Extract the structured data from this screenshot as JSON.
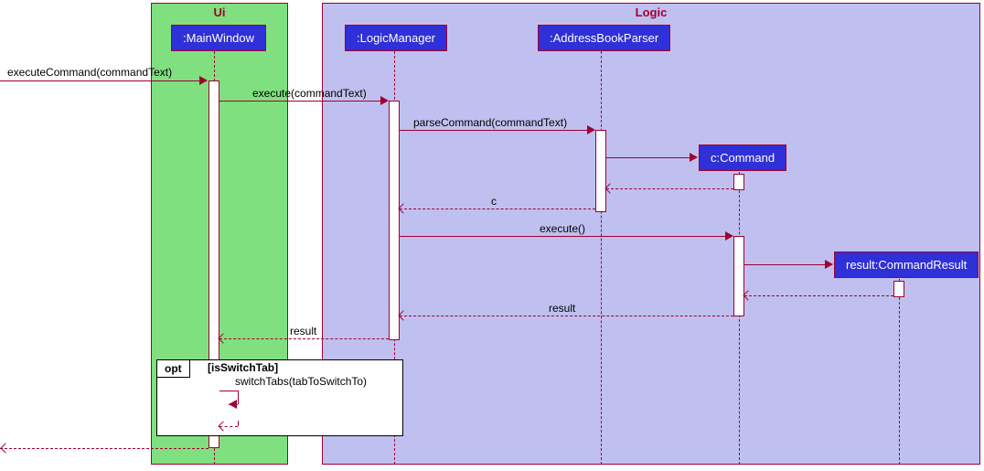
{
  "packages": {
    "ui": {
      "label": "Ui"
    },
    "logic": {
      "label": "Logic"
    }
  },
  "participants": {
    "mainWindow": ":MainWindow",
    "logicManager": ":LogicManager",
    "addressBookParser": ":AddressBookParser",
    "command": "c:Command",
    "commandResult": "result:CommandResult"
  },
  "messages": {
    "m1": "executeCommand(commandText)",
    "m2": "execute(commandText)",
    "m3": "parseCommand(commandText)",
    "r1": "c",
    "m4": "execute()",
    "r2": "result",
    "r3": "result",
    "optGuard": "[isSwitchTab]",
    "m5": "switchTabs(tabToSwitchTo)"
  },
  "fragments": {
    "opt": "opt"
  },
  "chart_data": {
    "type": "sequence-diagram",
    "packages": [
      {
        "name": "Ui",
        "participants": [
          ":MainWindow"
        ]
      },
      {
        "name": "Logic",
        "participants": [
          ":LogicManager",
          ":AddressBookParser",
          "c:Command",
          "result:CommandResult"
        ]
      }
    ],
    "lifelines": [
      ":MainWindow",
      ":LogicManager",
      ":AddressBookParser",
      "c:Command",
      "result:CommandResult"
    ],
    "messages": [
      {
        "from": "caller",
        "to": ":MainWindow",
        "label": "executeCommand(commandText)",
        "type": "sync"
      },
      {
        "from": ":MainWindow",
        "to": ":LogicManager",
        "label": "execute(commandText)",
        "type": "sync"
      },
      {
        "from": ":LogicManager",
        "to": ":AddressBookParser",
        "label": "parseCommand(commandText)",
        "type": "sync"
      },
      {
        "from": ":AddressBookParser",
        "to": "c:Command",
        "label": "",
        "type": "create"
      },
      {
        "from": "c:Command",
        "to": ":AddressBookParser",
        "label": "",
        "type": "return"
      },
      {
        "from": ":AddressBookParser",
        "to": ":LogicManager",
        "label": "c",
        "type": "return"
      },
      {
        "from": ":LogicManager",
        "to": "c:Command",
        "label": "execute()",
        "type": "sync"
      },
      {
        "from": "c:Command",
        "to": "result:CommandResult",
        "label": "",
        "type": "create"
      },
      {
        "from": "result:CommandResult",
        "to": "c:Command",
        "label": "",
        "type": "return"
      },
      {
        "from": "c:Command",
        "to": ":LogicManager",
        "label": "result",
        "type": "return"
      },
      {
        "from": ":LogicManager",
        "to": ":MainWindow",
        "label": "result",
        "type": "return"
      },
      {
        "fragment": "opt",
        "guard": "[isSwitchTab]",
        "messages": [
          {
            "from": ":MainWindow",
            "to": ":MainWindow",
            "label": "switchTabs(tabToSwitchTo)",
            "type": "self-sync"
          },
          {
            "from": ":MainWindow",
            "to": ":MainWindow",
            "label": "",
            "type": "self-return"
          }
        ]
      },
      {
        "from": ":MainWindow",
        "to": "caller",
        "label": "",
        "type": "return"
      }
    ]
  }
}
